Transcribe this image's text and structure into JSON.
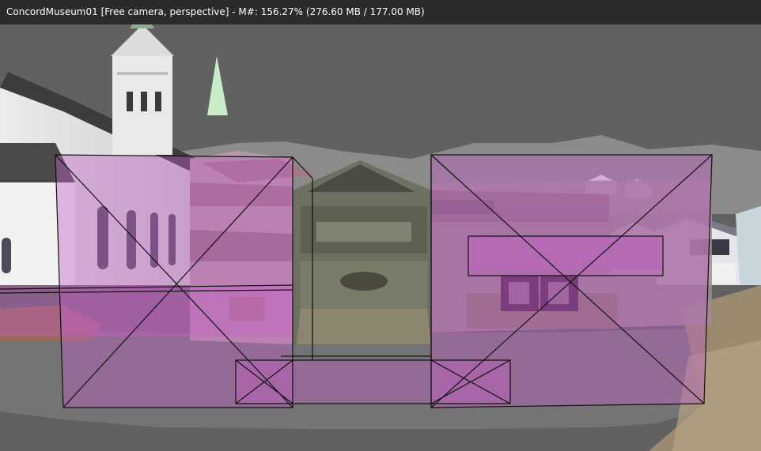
{
  "window": {
    "title": "ConcordMuseum01 [Free camera, perspective] - M#: 156.27% (276.60 MB / 177.00 MB)"
  },
  "viewport": {
    "background_color": "#616161",
    "bounds_color": "#c060c0",
    "bounds_edge_color": "#111111"
  }
}
